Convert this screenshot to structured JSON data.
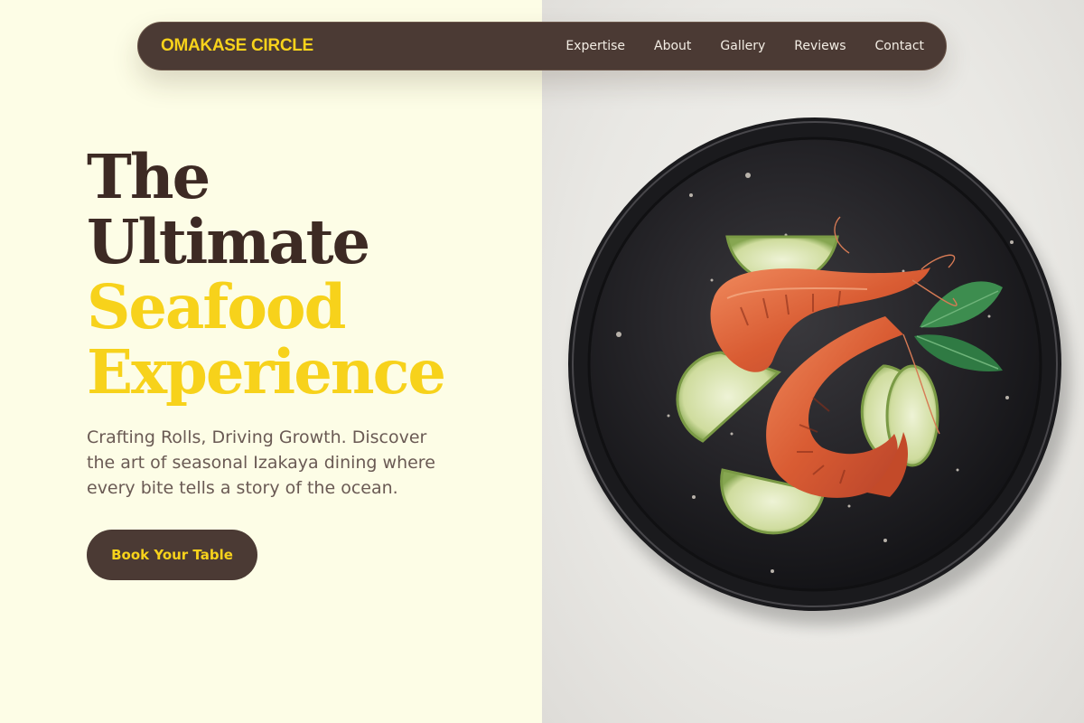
{
  "brand": {
    "name": "OMAKASE CIRCLE"
  },
  "nav": {
    "items": [
      {
        "label": "Expertise"
      },
      {
        "label": "About"
      },
      {
        "label": "Gallery"
      },
      {
        "label": "Reviews"
      },
      {
        "label": "Contact"
      }
    ]
  },
  "hero": {
    "line1": "The",
    "line2": "Ultimate",
    "line3": "Seafood",
    "line4": "Experience",
    "subtitle": "Crafting Rolls, Driving Growth. Discover the art of seasonal Izakaya dining where every bite tells a story of the ocean.",
    "cta_label": "Book Your Table"
  },
  "image": {
    "icon": "shrimp-plate-photo"
  },
  "colors": {
    "accent": "#f7d21b",
    "dark": "#4b3a34",
    "cream": "#fdfde6"
  }
}
